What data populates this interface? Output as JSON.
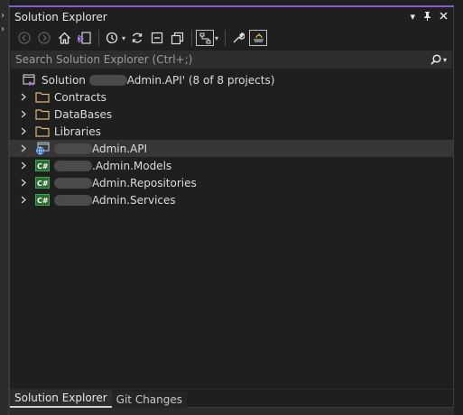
{
  "window": {
    "title": "Solution Explorer",
    "buttons": [
      "▾",
      "📌",
      "✕"
    ]
  },
  "toolbar": {
    "items": [
      "back-icon",
      "forward-icon",
      "home-icon",
      "switch-views-icon",
      "pending-changes-filter-icon",
      "sync-with-active-document-icon",
      "collapse-all-icon",
      "show-all-files-icon",
      "view-class-diagram-icon",
      "properties-icon",
      "preview-selected-items-icon"
    ]
  },
  "search": {
    "placeholder": "Search Solution Explorer (Ctrl+;)"
  },
  "tree": {
    "solution": {
      "prefix": "Solution",
      "suffix": "Admin.API' (8 of 8 projects)"
    },
    "folders": [
      "Contracts",
      "DataBases",
      "Libraries"
    ],
    "projects": [
      {
        "label": "Admin.API",
        "icon": "web-project-icon",
        "selected": true
      },
      {
        "label": ".Admin.Models",
        "icon": "csharp-project-icon"
      },
      {
        "label": "Admin.Repositories",
        "icon": "csharp-project-icon"
      },
      {
        "label": "Admin.Services",
        "icon": "csharp-project-icon"
      }
    ]
  },
  "tabs": [
    "Solution Explorer",
    "Git Changes"
  ],
  "colors": {
    "accent": "#7e62c9",
    "folder": "#dcb67a",
    "csharp": "#3fa34d",
    "selection": "#363636"
  }
}
